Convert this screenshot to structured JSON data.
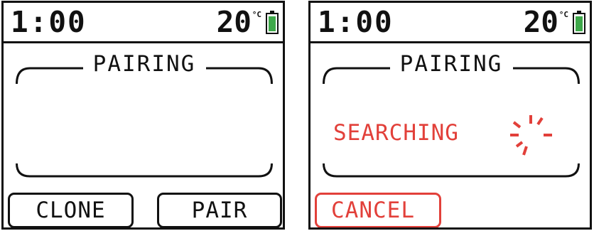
{
  "colors": {
    "ink": "#111111",
    "accent_red": "#e2403a",
    "battery_green": "#3ea84a"
  },
  "screens": [
    {
      "status": {
        "time": "1:00",
        "temperature": "20",
        "temperature_unit": "°C",
        "battery_icon": "battery-icon"
      },
      "panel_title": "PAIRING",
      "buttons": {
        "clone": "CLONE",
        "pair": "PAIR"
      }
    },
    {
      "status": {
        "time": "1:00",
        "temperature": "20",
        "temperature_unit": "°C",
        "battery_icon": "battery-icon"
      },
      "panel_title": "PAIRING",
      "searching_text": "SEARCHING",
      "spinner_icon": "loading-spinner-icon",
      "buttons": {
        "cancel": "CANCEL"
      }
    }
  ]
}
